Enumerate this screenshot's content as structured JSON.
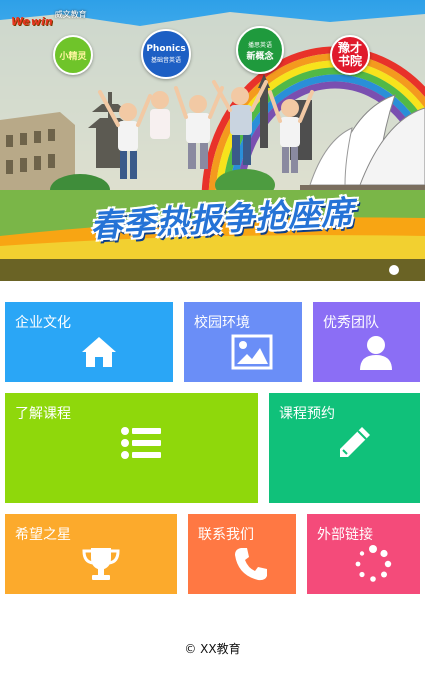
{
  "banner": {
    "logo": {
      "mark": "We",
      "mark_suffix": "win",
      "word": "威文教育"
    },
    "badges": [
      {
        "title": "小精灵",
        "sub": ""
      },
      {
        "title": "Phonics",
        "sub": "基础音英语"
      },
      {
        "title": "新概念",
        "sub": "播思英语"
      },
      {
        "title": "豫才书院",
        "sub": ""
      }
    ],
    "slogan": "春季热报争抢座席",
    "colors": {
      "sky": "#2ea0e8",
      "slogan": "#2573d6",
      "strip": "#6a6325"
    }
  },
  "tiles": [
    {
      "id": "culture",
      "label": "企业文化",
      "icon": "home-icon",
      "color": "#2aa6f6"
    },
    {
      "id": "campus",
      "label": "校园环境",
      "icon": "image-icon",
      "color": "#6a8ef7"
    },
    {
      "id": "team",
      "label": "优秀团队",
      "icon": "user-icon",
      "color": "#8b6ef5"
    },
    {
      "id": "courses",
      "label": "了解课程",
      "icon": "list-icon",
      "color": "#8fd80b"
    },
    {
      "id": "booking",
      "label": "课程预约",
      "icon": "pencil-icon",
      "color": "#10c17a"
    },
    {
      "id": "star",
      "label": "希望之星",
      "icon": "trophy-icon",
      "color": "#fcaa2c"
    },
    {
      "id": "contact",
      "label": "联系我们",
      "icon": "phone-icon",
      "color": "#ff7843"
    },
    {
      "id": "links",
      "label": "外部链接",
      "icon": "spinner-icon",
      "color": "#f44b7a"
    }
  ],
  "footer": {
    "copyright": "© XX教育"
  }
}
